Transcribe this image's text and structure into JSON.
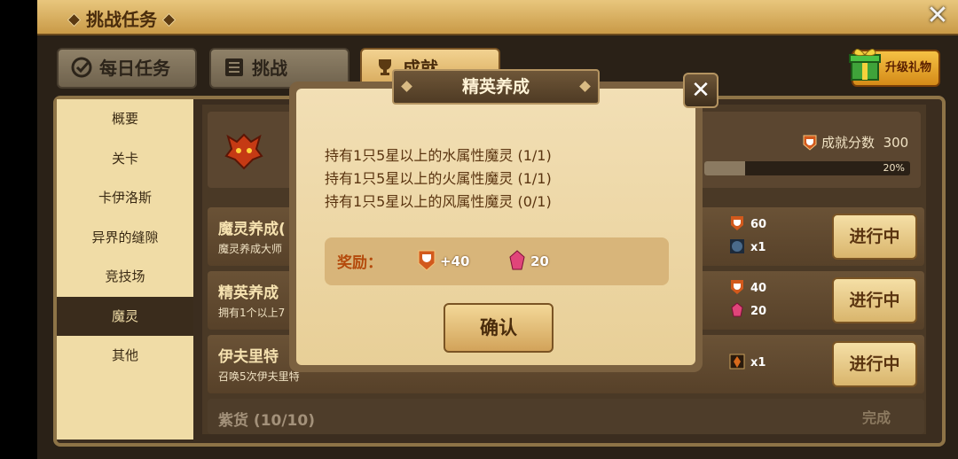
{
  "header": {
    "title": "挑战任务"
  },
  "tabs": [
    {
      "label": "每日任务"
    },
    {
      "label": "挑战"
    },
    {
      "label": "成就"
    }
  ],
  "gift_button": {
    "label": "升级礼物"
  },
  "sidebar": {
    "items": [
      {
        "label": "概要"
      },
      {
        "label": "关卡"
      },
      {
        "label": "卡伊洛斯"
      },
      {
        "label": "异界的缝隙"
      },
      {
        "label": "竞技场"
      },
      {
        "label": "魔灵"
      },
      {
        "label": "其他"
      }
    ]
  },
  "summary": {
    "score_label": "成就分数",
    "score_value": "300",
    "progress_percent": 20,
    "progress_text": "20%"
  },
  "rows": [
    {
      "title": "魔灵养成(",
      "subtitle": "魔灵养成大师",
      "reward1": "60",
      "reward2": "x1",
      "button": "进行中"
    },
    {
      "title": "精英养成",
      "subtitle": "拥有1个以上7",
      "reward1": "40",
      "reward2": "20",
      "button": "进行中"
    },
    {
      "title": "伊夫里特",
      "subtitle": "召唤5次伊夫里特",
      "reward1": "x1",
      "button": "进行中"
    },
    {
      "title": "紫货 (10/10)",
      "status": "完成"
    }
  ],
  "modal": {
    "title": "精英养成",
    "conditions": [
      "持有1只5星以上的水属性魔灵 (1/1)",
      "持有1只5星以上的火属性魔灵 (1/1)",
      "持有1只5星以上的风属性魔灵 (0/1)"
    ],
    "reward_label": "奖励：",
    "reward_points": "+40",
    "reward_crystals": "20",
    "confirm_label": "确认"
  },
  "colors": {
    "accent_gold": "#d9b56c",
    "reward_label": "#b44a0c",
    "panel_bg": "#4a3926"
  }
}
